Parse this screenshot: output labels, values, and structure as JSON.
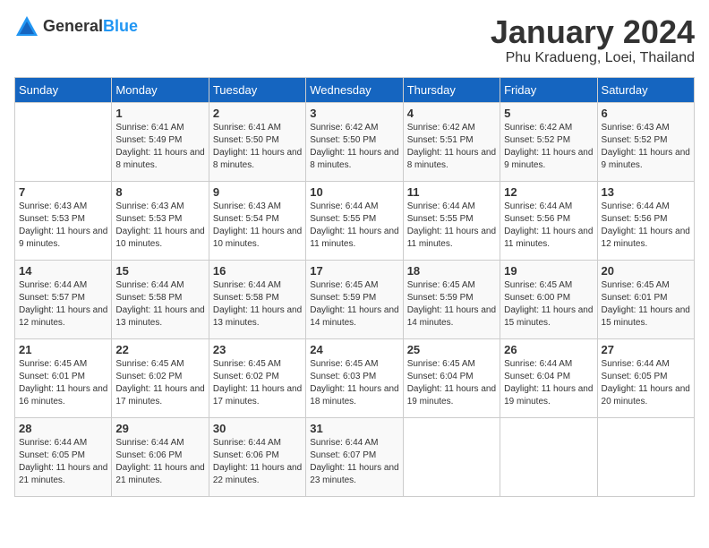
{
  "header": {
    "logo_general": "General",
    "logo_blue": "Blue",
    "title": "January 2024",
    "location": "Phu Kradueng, Loei, Thailand"
  },
  "calendar": {
    "days_of_week": [
      "Sunday",
      "Monday",
      "Tuesday",
      "Wednesday",
      "Thursday",
      "Friday",
      "Saturday"
    ],
    "weeks": [
      [
        {
          "day": "",
          "info": ""
        },
        {
          "day": "1",
          "info": "Sunrise: 6:41 AM\nSunset: 5:49 PM\nDaylight: 11 hours and 8 minutes."
        },
        {
          "day": "2",
          "info": "Sunrise: 6:41 AM\nSunset: 5:50 PM\nDaylight: 11 hours and 8 minutes."
        },
        {
          "day": "3",
          "info": "Sunrise: 6:42 AM\nSunset: 5:50 PM\nDaylight: 11 hours and 8 minutes."
        },
        {
          "day": "4",
          "info": "Sunrise: 6:42 AM\nSunset: 5:51 PM\nDaylight: 11 hours and 8 minutes."
        },
        {
          "day": "5",
          "info": "Sunrise: 6:42 AM\nSunset: 5:52 PM\nDaylight: 11 hours and 9 minutes."
        },
        {
          "day": "6",
          "info": "Sunrise: 6:43 AM\nSunset: 5:52 PM\nDaylight: 11 hours and 9 minutes."
        }
      ],
      [
        {
          "day": "7",
          "info": "Sunrise: 6:43 AM\nSunset: 5:53 PM\nDaylight: 11 hours and 9 minutes."
        },
        {
          "day": "8",
          "info": "Sunrise: 6:43 AM\nSunset: 5:53 PM\nDaylight: 11 hours and 10 minutes."
        },
        {
          "day": "9",
          "info": "Sunrise: 6:43 AM\nSunset: 5:54 PM\nDaylight: 11 hours and 10 minutes."
        },
        {
          "day": "10",
          "info": "Sunrise: 6:44 AM\nSunset: 5:55 PM\nDaylight: 11 hours and 11 minutes."
        },
        {
          "day": "11",
          "info": "Sunrise: 6:44 AM\nSunset: 5:55 PM\nDaylight: 11 hours and 11 minutes."
        },
        {
          "day": "12",
          "info": "Sunrise: 6:44 AM\nSunset: 5:56 PM\nDaylight: 11 hours and 11 minutes."
        },
        {
          "day": "13",
          "info": "Sunrise: 6:44 AM\nSunset: 5:56 PM\nDaylight: 11 hours and 12 minutes."
        }
      ],
      [
        {
          "day": "14",
          "info": "Sunrise: 6:44 AM\nSunset: 5:57 PM\nDaylight: 11 hours and 12 minutes."
        },
        {
          "day": "15",
          "info": "Sunrise: 6:44 AM\nSunset: 5:58 PM\nDaylight: 11 hours and 13 minutes."
        },
        {
          "day": "16",
          "info": "Sunrise: 6:44 AM\nSunset: 5:58 PM\nDaylight: 11 hours and 13 minutes."
        },
        {
          "day": "17",
          "info": "Sunrise: 6:45 AM\nSunset: 5:59 PM\nDaylight: 11 hours and 14 minutes."
        },
        {
          "day": "18",
          "info": "Sunrise: 6:45 AM\nSunset: 5:59 PM\nDaylight: 11 hours and 14 minutes."
        },
        {
          "day": "19",
          "info": "Sunrise: 6:45 AM\nSunset: 6:00 PM\nDaylight: 11 hours and 15 minutes."
        },
        {
          "day": "20",
          "info": "Sunrise: 6:45 AM\nSunset: 6:01 PM\nDaylight: 11 hours and 15 minutes."
        }
      ],
      [
        {
          "day": "21",
          "info": "Sunrise: 6:45 AM\nSunset: 6:01 PM\nDaylight: 11 hours and 16 minutes."
        },
        {
          "day": "22",
          "info": "Sunrise: 6:45 AM\nSunset: 6:02 PM\nDaylight: 11 hours and 17 minutes."
        },
        {
          "day": "23",
          "info": "Sunrise: 6:45 AM\nSunset: 6:02 PM\nDaylight: 11 hours and 17 minutes."
        },
        {
          "day": "24",
          "info": "Sunrise: 6:45 AM\nSunset: 6:03 PM\nDaylight: 11 hours and 18 minutes."
        },
        {
          "day": "25",
          "info": "Sunrise: 6:45 AM\nSunset: 6:04 PM\nDaylight: 11 hours and 19 minutes."
        },
        {
          "day": "26",
          "info": "Sunrise: 6:44 AM\nSunset: 6:04 PM\nDaylight: 11 hours and 19 minutes."
        },
        {
          "day": "27",
          "info": "Sunrise: 6:44 AM\nSunset: 6:05 PM\nDaylight: 11 hours and 20 minutes."
        }
      ],
      [
        {
          "day": "28",
          "info": "Sunrise: 6:44 AM\nSunset: 6:05 PM\nDaylight: 11 hours and 21 minutes."
        },
        {
          "day": "29",
          "info": "Sunrise: 6:44 AM\nSunset: 6:06 PM\nDaylight: 11 hours and 21 minutes."
        },
        {
          "day": "30",
          "info": "Sunrise: 6:44 AM\nSunset: 6:06 PM\nDaylight: 11 hours and 22 minutes."
        },
        {
          "day": "31",
          "info": "Sunrise: 6:44 AM\nSunset: 6:07 PM\nDaylight: 11 hours and 23 minutes."
        },
        {
          "day": "",
          "info": ""
        },
        {
          "day": "",
          "info": ""
        },
        {
          "day": "",
          "info": ""
        }
      ]
    ]
  }
}
